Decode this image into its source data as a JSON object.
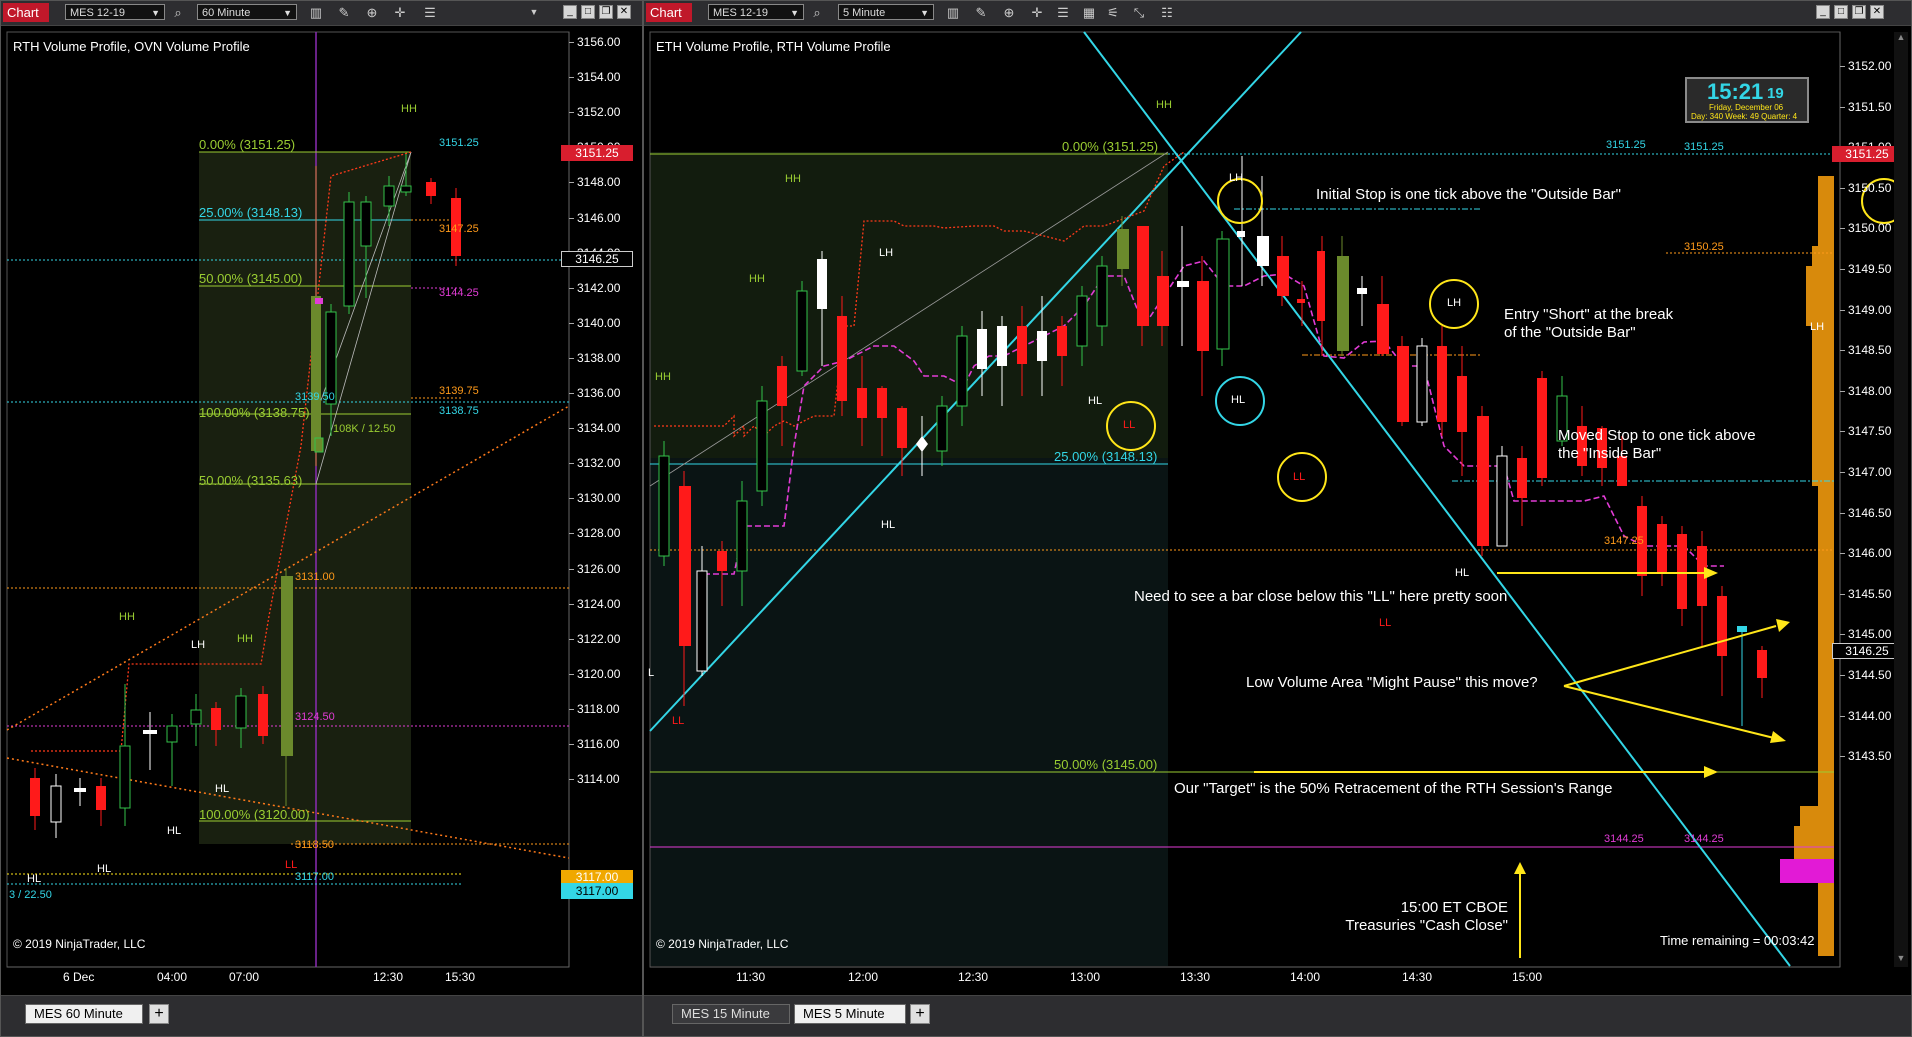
{
  "left": {
    "chart_label": "Chart",
    "instrument": "MES 12-19",
    "interval": "60 Minute",
    "title": "RTH Volume Profile, OVN Volume Profile",
    "copyright": "© 2019 NinjaTrader, LLC",
    "tabs": [
      {
        "label": "MES  60 Minute"
      }
    ],
    "add_tab": "+",
    "price_axis": [
      "3156.00",
      "3154.00",
      "3152.00",
      "3150.00",
      "3148.00",
      "3146.00",
      "3144.00",
      "3142.00",
      "3140.00",
      "3138.00",
      "3136.00",
      "3134.00",
      "3132.00",
      "3130.00",
      "3128.00",
      "3126.00",
      "3124.00",
      "3122.00",
      "3120.00",
      "3118.00",
      "3116.00",
      "3114.00"
    ],
    "time_axis": [
      "6 Dec",
      "04:00",
      "07:00",
      "12:30",
      "15:30"
    ],
    "price_markers": {
      "current": "3151.25",
      "last": "3146.25",
      "low_a": "3117.00",
      "low_b": "3117.00"
    },
    "fib": [
      "0.00% (3151.25)",
      "25.00% (3148.13)",
      "50.00% (3145.00)",
      "100.00% (3138.75)",
      "50.00% (3135.63)",
      "100.00% (3120.00)"
    ],
    "levels": [
      "3151.25",
      "3147.25",
      "3144.25",
      "3139.75",
      "3138.75",
      "3139.50",
      "3131.00",
      "3124.50",
      "3118.50",
      "3117.00"
    ],
    "swing_labels": [
      "HH",
      "HH",
      "HH",
      "LH",
      "HL",
      "HL",
      "HL",
      "LL"
    ],
    "volume_text": "108K / 12.50",
    "edge_text": "3 / 22.50"
  },
  "right": {
    "chart_label": "Chart",
    "instrument": "MES 12-19",
    "interval": "5 Minute",
    "title": "ETH Volume Profile, RTH Volume Profile",
    "copyright": "© 2019 NinjaTrader, LLC",
    "tabs": [
      {
        "label": "MES  15 Minute"
      },
      {
        "label": "MES  5 Minute"
      }
    ],
    "add_tab": "+",
    "price_axis": [
      "3152.00",
      "3151.50",
      "3151.00",
      "3150.50",
      "3150.00",
      "3149.50",
      "3149.00",
      "3148.50",
      "3148.00",
      "3147.50",
      "3147.00",
      "3146.50",
      "3146.00",
      "3145.50",
      "3145.00",
      "3144.50",
      "3144.00",
      "3143.50"
    ],
    "time_axis": [
      "11:30",
      "12:00",
      "12:30",
      "13:00",
      "13:30",
      "14:00",
      "14:30",
      "15:00"
    ],
    "price_markers": {
      "current": "3151.25",
      "last": "3146.25"
    },
    "fib": [
      "0.00% (3151.25)",
      "25.00% (3148.13)",
      "50.00% (3145.00)"
    ],
    "levels": [
      "3151.25",
      "3151.25",
      "3150.25",
      "3147.25",
      "3144.25",
      "3144.25"
    ],
    "clock": {
      "time": "15:21",
      "seconds": "19",
      "date": "Friday, December 06",
      "sub": "Day: 340  Week: 49  Quarter: 4"
    },
    "time_remaining": "Time remaining = 00:03:42",
    "swing_labels": [
      "HH",
      "HH",
      "HH",
      "HH",
      "LH",
      "LH",
      "LH",
      "LH",
      "HL",
      "HL",
      "HL",
      "HL",
      "LL",
      "LL",
      "LL",
      "LL",
      "L"
    ],
    "annotations": {
      "initial_stop": "Initial Stop is one tick above the \"Outside Bar\"",
      "entry_1": "Entry \"Short\" at the break",
      "entry_2": "of the \"Outside Bar\"",
      "moved_1": "Moved Stop to one tick above",
      "moved_2": "the \"Inside Bar\"",
      "need": "Need to see a bar close below this \"LL\" here pretty soon",
      "lowvol": "Low Volume Area \"Might Pause\" this move?",
      "target": "Our \"Target\" is the 50% Retracement of the RTH Session's Range",
      "cboe_1": "15:00 ET CBOE",
      "cboe_2": "Treasuries \"Cash Close\""
    }
  },
  "colors": {
    "up_candle": "#ffffff",
    "down_candle": "#ff1a1a",
    "fib_green": "#9acd32",
    "cyan": "#33d6e6",
    "magenta": "#e23cd6",
    "orange": "#ff9a1a",
    "yellow": "#ffe619",
    "price_tag": "#d81e2e"
  }
}
